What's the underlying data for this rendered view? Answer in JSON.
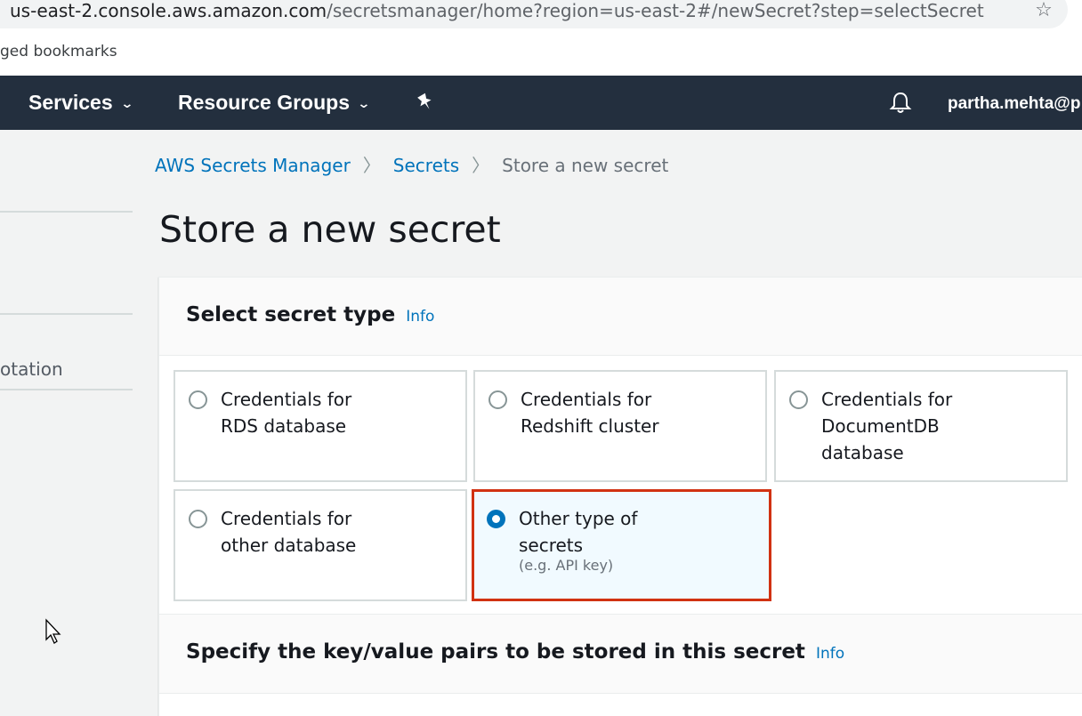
{
  "browser": {
    "url_host": "us-east-2.console.aws.amazon.com",
    "url_path": "/secretsmanager/home?region=us-east-2#/newSecret?step=selectSecret",
    "bookmarks_label": "ged bookmarks"
  },
  "nav": {
    "services_label": "Services",
    "resource_groups_label": "Resource Groups",
    "user_label": "partha.mehta@p",
    "background_color": "#232f3e"
  },
  "sidebar": {
    "partial_label": "otation"
  },
  "breadcrumb": {
    "items": [
      {
        "label": "AWS Secrets Manager"
      },
      {
        "label": "Secrets"
      },
      {
        "label": "Store a new secret"
      }
    ],
    "separator": ">"
  },
  "page": {
    "title": "Store a new secret"
  },
  "select_type": {
    "title": "Select secret type",
    "info_label": "Info",
    "options": [
      {
        "line1": "Credentials for",
        "line2": "RDS database",
        "line3": "",
        "selected": false
      },
      {
        "line1": "Credentials for",
        "line2": "Redshift cluster",
        "line3": "",
        "selected": false
      },
      {
        "line1": "Credentials for",
        "line2": "DocumentDB",
        "line3": "database",
        "selected": false
      },
      {
        "line1": "Credentials for",
        "line2": "other database",
        "line3": "",
        "selected": false
      },
      {
        "line1": "Other type of",
        "line2": "secrets",
        "sub": "(e.g. API key)",
        "selected": true
      }
    ]
  },
  "key_value": {
    "title": "Specify the key/value pairs to be stored in this secret",
    "info_label": "Info"
  },
  "colors": {
    "link": "#0073bb",
    "highlight_border": "#d13212",
    "selected_bg": "#f1faff"
  }
}
